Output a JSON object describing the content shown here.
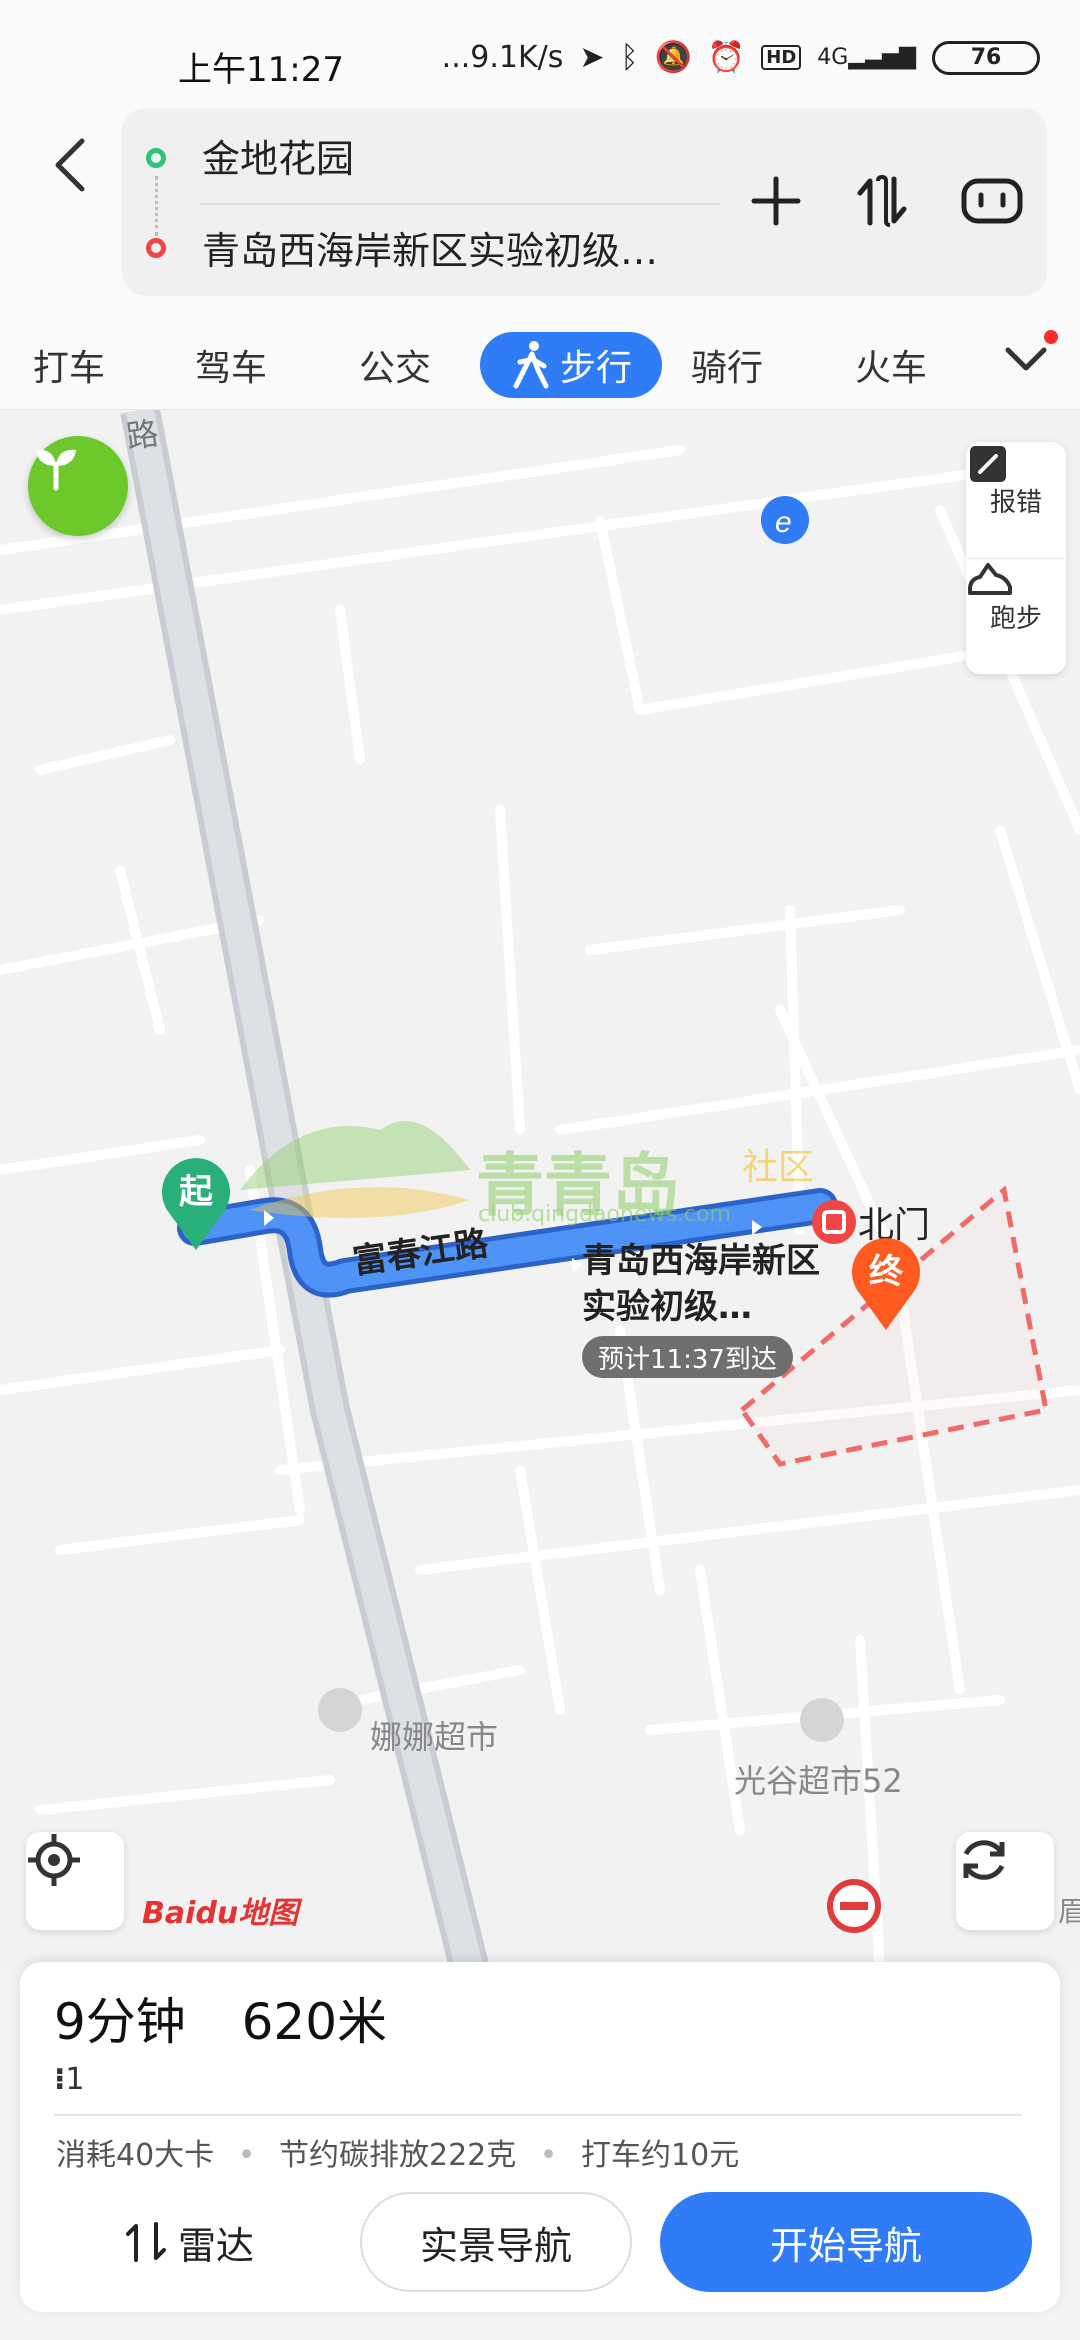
{
  "status_bar": {
    "time": "上午11:27",
    "network_speed": "...9.1K/s",
    "network_type": "4G",
    "battery": "76",
    "hd_badge": "HD"
  },
  "header": {
    "start_location": "金地花园",
    "end_location": "青岛西海岸新区实验初级…",
    "colors": {
      "start_dot": "#2bc37a",
      "end_dot": "#f04646"
    }
  },
  "tabs": [
    {
      "label": "打车",
      "active": false
    },
    {
      "label": "驾车",
      "active": false
    },
    {
      "label": "公交",
      "active": false
    },
    {
      "label": "步行",
      "active": true
    },
    {
      "label": "骑行",
      "active": false
    },
    {
      "label": "火车",
      "active": false
    }
  ],
  "map": {
    "road_name_top": "路",
    "route_road_name": "富春江路",
    "destination_name_line1": "青岛西海岸新区",
    "destination_name_line2": "实验初级…",
    "eta_label": "预计11:37到达",
    "gate_label": "北门",
    "start_marker": "起",
    "end_marker": "终",
    "poi_1": "娜娜超市",
    "poi_2": "光谷超市52",
    "edge_label": "眉",
    "watermark_main": "青青岛",
    "watermark_sub": "社区",
    "watermark_url": "club.qingdaonews.com",
    "brand": "Baidu地图",
    "route_color": "#3d86f2"
  },
  "side_tools": {
    "report_label": "报错",
    "run_label": "跑步"
  },
  "panel": {
    "duration": "9分钟",
    "distance": "620米",
    "traffic_lights": "1",
    "calories": "消耗40大卡",
    "carbon": "节约碳排放222克",
    "taxi": "打车约10元",
    "radar_label": "雷达",
    "ar_nav_label": "实景导航",
    "start_nav_label": "开始导航"
  }
}
